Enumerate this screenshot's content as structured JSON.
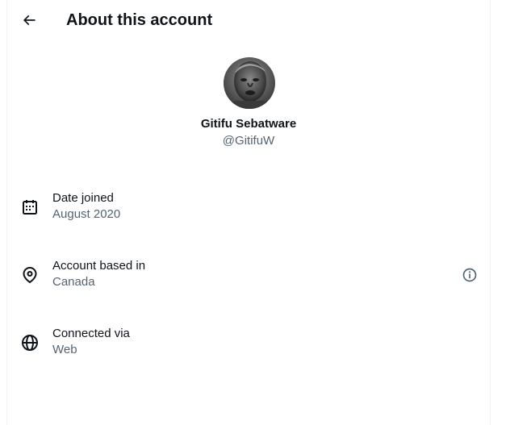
{
  "header": {
    "title": "About this account",
    "back_icon": "arrow-left-icon"
  },
  "profile": {
    "display_name": "Gitifu Sebatware",
    "handle": "@GitifuW"
  },
  "details": [
    {
      "icon": "calendar-icon",
      "label": "Date joined",
      "value": "August 2020"
    },
    {
      "icon": "location-pin-icon",
      "label": "Account based in",
      "value": "Canada",
      "trailing_icon": "info-icon"
    },
    {
      "icon": "globe-icon",
      "label": "Connected via",
      "value": "Web"
    }
  ],
  "colors": {
    "primary_text": "#0f1419",
    "secondary_text": "#536471",
    "border": "#eff3f4"
  }
}
